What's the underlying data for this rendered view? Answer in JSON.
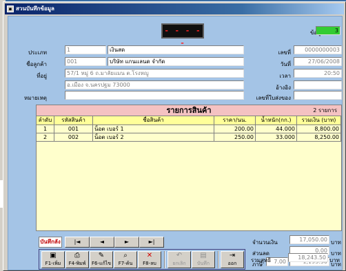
{
  "window": {
    "title": "สวนบันทึกข้อมูล"
  },
  "display": {
    "led": "- - - - -"
  },
  "record": {
    "label": "ข้อมูล",
    "value": "3"
  },
  "left_fields": {
    "type_label": "ประเภท",
    "type_code": "1",
    "type_name": "เงินสด",
    "customer_label": "ชื่อลูกค้า",
    "customer_code": "001",
    "customer_name": "บริษัท แกนแลนด จำกัด",
    "address_label": "ที่อยู่",
    "address_1": "57/1 หมู่ 6 ถ.มาลัยแมน ต.โรงหญู",
    "address_2": "อ.เมือง จ.นครปฐม 73000",
    "note_label": "หมายเหตุ",
    "note": ""
  },
  "right_fields": {
    "docno_label": "เลขที่",
    "docno": "0000000003",
    "date_label": "วันที่",
    "date": "27/06/2008",
    "time_label": "เวลา",
    "time": "20:50",
    "ref_label": "อ้างอิง",
    "ref": "",
    "deliveryno_label": "เลขที่ใบส่งของ",
    "deliveryno": ""
  },
  "grid": {
    "title": "รายการสินค้า",
    "count": "2  รายการ",
    "columns": [
      "ลำดับ",
      "รหัสสินค้า",
      "ชื่อสินค้า",
      "ราคา/นน.",
      "น้ำหนัก(กก.)",
      "รวมเงิน (บาท)"
    ],
    "rows": [
      [
        "1",
        "001",
        "น็อต เบอร์ 1",
        "200.00",
        "44.000",
        "8,800.00"
      ],
      [
        "2",
        "002",
        "น็อต เบอร์ 2",
        "250.00",
        "33.000",
        "8,250.00"
      ]
    ]
  },
  "nav": {
    "label": "บันทึกลัง",
    "first": "|◄",
    "prev": "◄",
    "next": "►",
    "last": "►|"
  },
  "toolbar": [
    {
      "icon": "▣",
      "label": "F1-เพิ่ม",
      "enabled": true
    },
    {
      "icon": "⎙",
      "label": "F4-พิมพ์",
      "enabled": true
    },
    {
      "icon": "✎",
      "label": "F6-แก้ไข",
      "enabled": true
    },
    {
      "icon": "⌕",
      "label": "F7-ค้น",
      "enabled": true
    },
    {
      "icon": "✕",
      "label": "F8-ลบ",
      "enabled": true
    },
    {
      "icon": "↶",
      "label": "ยกเลิก",
      "enabled": false
    },
    {
      "icon": "▤",
      "label": "บันทึก",
      "enabled": false
    },
    {
      "icon": "⇥",
      "label": "ออก",
      "enabled": true
    }
  ],
  "totals": {
    "amount_label": "จำนวนเงิน",
    "amount": "17,050.00",
    "discount_label": "ส่วนลด",
    "discount": "0.00",
    "vat_label": "ภาษี",
    "vat_rate": "7.00",
    "vat": "1,193.50",
    "net_label": "รวมสุทธิ",
    "net": "18,243.50",
    "unit": "บาท"
  },
  "colors": {
    "form_bg": "#a4c4e6",
    "grid_bg": "#ffffcc",
    "grid_header": "#f4c2c2",
    "record_green": "#33cc33",
    "led_red": "#ff2020"
  }
}
